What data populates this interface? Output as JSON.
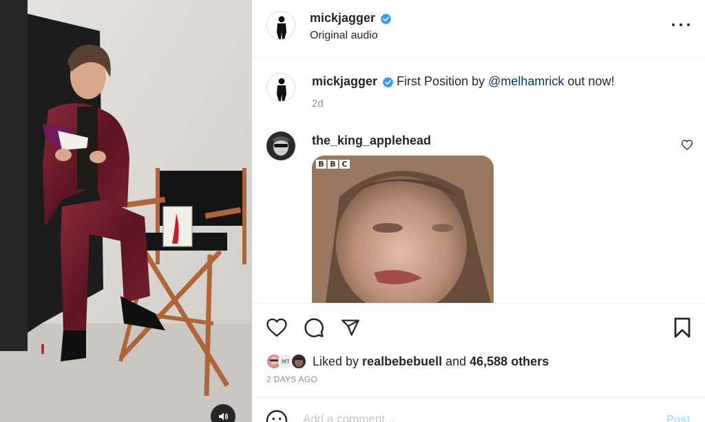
{
  "post": {
    "author": "mickjagger",
    "audio_label": "Original audio",
    "more_label": "More options"
  },
  "caption": {
    "username": "mickjagger",
    "text_before": "First Position by ",
    "mention": "@melhamrick",
    "text_after": " out now!",
    "time": "2d"
  },
  "comment": {
    "username": "the_king_applehead",
    "gif_badge": [
      "B",
      "B",
      "C"
    ]
  },
  "likes": {
    "prefix": "Liked by ",
    "user": "realbebebuell",
    "middle": " and ",
    "count": "46,588 others"
  },
  "date": "2 DAYS AGO",
  "composer": {
    "placeholder": "Add a comment...",
    "post_label": "Post"
  },
  "icons": [
    "verified-badge-icon",
    "more-icon",
    "heart-icon",
    "comment-icon",
    "share-icon",
    "bookmark-icon",
    "emoji-icon",
    "speaker-icon"
  ],
  "colors": {
    "verified": "#3897f0",
    "mention": "#00376b",
    "post_disabled": "#b2dffc",
    "muted": "#8e8e8e"
  }
}
